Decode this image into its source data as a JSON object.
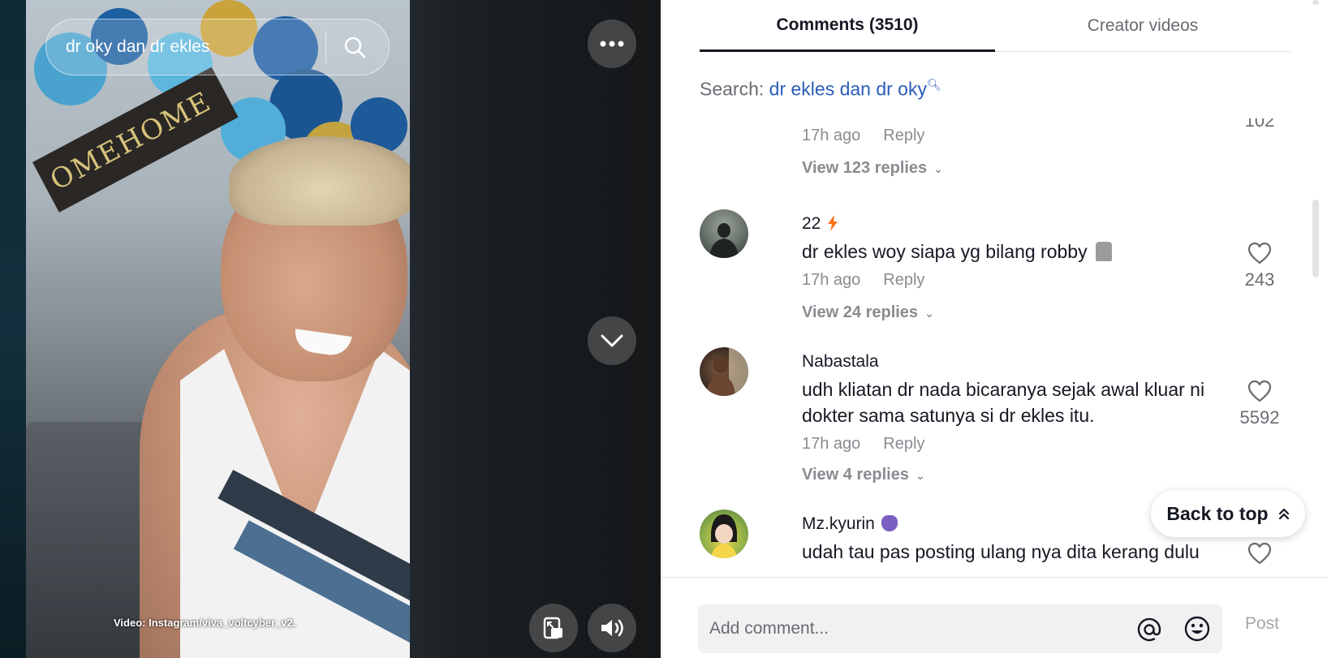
{
  "video": {
    "search_query": "dr oky dan dr ekles",
    "banner_text": "OMEHOME",
    "caption": "Video: Instagram/viva_voltcyber_v2.",
    "icons": {
      "search": "search-icon",
      "more": "more-icon",
      "down": "chevron-down-icon",
      "mini_player": "mini-player-icon",
      "volume": "volume-icon"
    }
  },
  "tabs": [
    {
      "label": "Comments (3510)",
      "active": true
    },
    {
      "label": "Creator videos",
      "active": false
    }
  ],
  "search_row": {
    "prefix": "Search:",
    "query": "dr ekles dan dr oky",
    "icon": "search-icon"
  },
  "comments": [
    {
      "user": "",
      "text": "",
      "time": "17h ago",
      "reply": "Reply",
      "likes": "102",
      "view_replies": "View 123 replies"
    },
    {
      "user": "22",
      "badge": "lightning-icon",
      "text": "dr ekles woy siapa yg bilang robby",
      "emoji": "moai-emoji",
      "time": "17h ago",
      "reply": "Reply",
      "likes": "243",
      "view_replies": "View 24 replies"
    },
    {
      "user": "Nabastala",
      "text": "udh kliatan dr nada bicaranya sejak awal kluar ni dokter sama satunya si dr ekles itu.",
      "time": "17h ago",
      "reply": "Reply",
      "likes": "5592",
      "view_replies": "View 4 replies"
    },
    {
      "user": "Mz.kyurin",
      "badge": "cat-emoji",
      "text": "udah tau pas posting ulang nya dita kerang dulu",
      "likes": ""
    }
  ],
  "back_to_top": {
    "label": "Back to top",
    "icon": "double-chevron-up-icon"
  },
  "comment_box": {
    "placeholder": "Add comment...",
    "post_label": "Post",
    "mention_icon": "at-icon",
    "emoji_icon": "emoji-icon"
  },
  "colors": {
    "accent_link": "#2b5db9",
    "muted_text": "#8a8b91",
    "divider": "#e3e3e4",
    "badge_orange": "#fe6f19"
  }
}
